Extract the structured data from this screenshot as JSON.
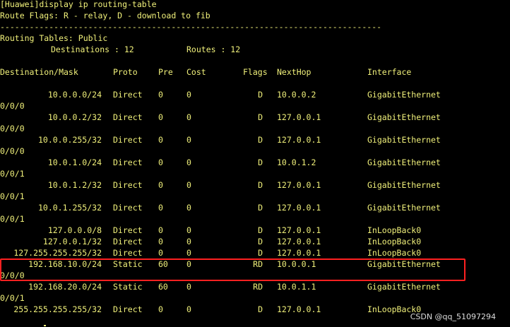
{
  "terminal": {
    "prompt_line": "[Huawei]display ip routing-table",
    "flags_line": "Route Flags: R - relay, D - download to fib",
    "separator": "------------------------------------------------------------------------------",
    "tables_line": "Routing Tables: Public",
    "destinations_label": "Destinations : 12",
    "routes_label": "Routes : 12",
    "headers": {
      "destination": "Destination/Mask",
      "proto": "Proto",
      "pre": "Pre",
      "cost": "Cost",
      "flags": "Flags",
      "nexthop": "NextHop",
      "interface": "Interface"
    },
    "rows": [
      {
        "dest": "10.0.0.0/24",
        "proto": "Direct",
        "pre": "0",
        "cost": "0",
        "flags": "D",
        "nexthop": "10.0.0.2",
        "iface": "GigabitEthernet",
        "iface2": "0/0/0"
      },
      {
        "dest": "10.0.0.2/32",
        "proto": "Direct",
        "pre": "0",
        "cost": "0",
        "flags": "D",
        "nexthop": "127.0.0.1",
        "iface": "GigabitEthernet",
        "iface2": "0/0/0"
      },
      {
        "dest": "10.0.0.255/32",
        "proto": "Direct",
        "pre": "0",
        "cost": "0",
        "flags": "D",
        "nexthop": "127.0.0.1",
        "iface": "GigabitEthernet",
        "iface2": "0/0/0"
      },
      {
        "dest": "10.0.1.0/24",
        "proto": "Direct",
        "pre": "0",
        "cost": "0",
        "flags": "D",
        "nexthop": "10.0.1.2",
        "iface": "GigabitEthernet",
        "iface2": "0/0/1"
      },
      {
        "dest": "10.0.1.2/32",
        "proto": "Direct",
        "pre": "0",
        "cost": "0",
        "flags": "D",
        "nexthop": "127.0.0.1",
        "iface": "GigabitEthernet",
        "iface2": "0/0/1"
      },
      {
        "dest": "10.0.1.255/32",
        "proto": "Direct",
        "pre": "0",
        "cost": "0",
        "flags": "D",
        "nexthop": "127.0.0.1",
        "iface": "GigabitEthernet",
        "iface2": "0/0/1"
      },
      {
        "dest": "127.0.0.0/8",
        "proto": "Direct",
        "pre": "0",
        "cost": "0",
        "flags": "D",
        "nexthop": "127.0.0.1",
        "iface": "InLoopBack0",
        "iface2": ""
      },
      {
        "dest": "127.0.0.1/32",
        "proto": "Direct",
        "pre": "0",
        "cost": "0",
        "flags": "D",
        "nexthop": "127.0.0.1",
        "iface": "InLoopBack0",
        "iface2": ""
      },
      {
        "dest": "127.255.255.255/32",
        "proto": "Direct",
        "pre": "0",
        "cost": "0",
        "flags": "D",
        "nexthop": "127.0.0.1",
        "iface": "InLoopBack0",
        "iface2": ""
      },
      {
        "dest": "192.168.10.0/24",
        "proto": "Static",
        "pre": "60",
        "cost": "0",
        "flags": "RD",
        "nexthop": "10.0.0.1",
        "iface": "GigabitEthernet",
        "iface2": "0/0/0"
      },
      {
        "dest": "192.168.20.0/24",
        "proto": "Static",
        "pre": "60",
        "cost": "0",
        "flags": "RD",
        "nexthop": "10.0.1.1",
        "iface": "GigabitEthernet",
        "iface2": "0/0/1"
      },
      {
        "dest": "255.255.255.255/32",
        "proto": "Direct",
        "pre": "0",
        "cost": "0",
        "flags": "D",
        "nexthop": "127.0.0.1",
        "iface": "InLoopBack0",
        "iface2": ""
      }
    ],
    "watermark": "CSDN @qq_51097294"
  },
  "colors": {
    "background": "#000000",
    "text": "#f0f07a",
    "highlight_border": "#ff2020",
    "watermark": "#ffffff"
  }
}
